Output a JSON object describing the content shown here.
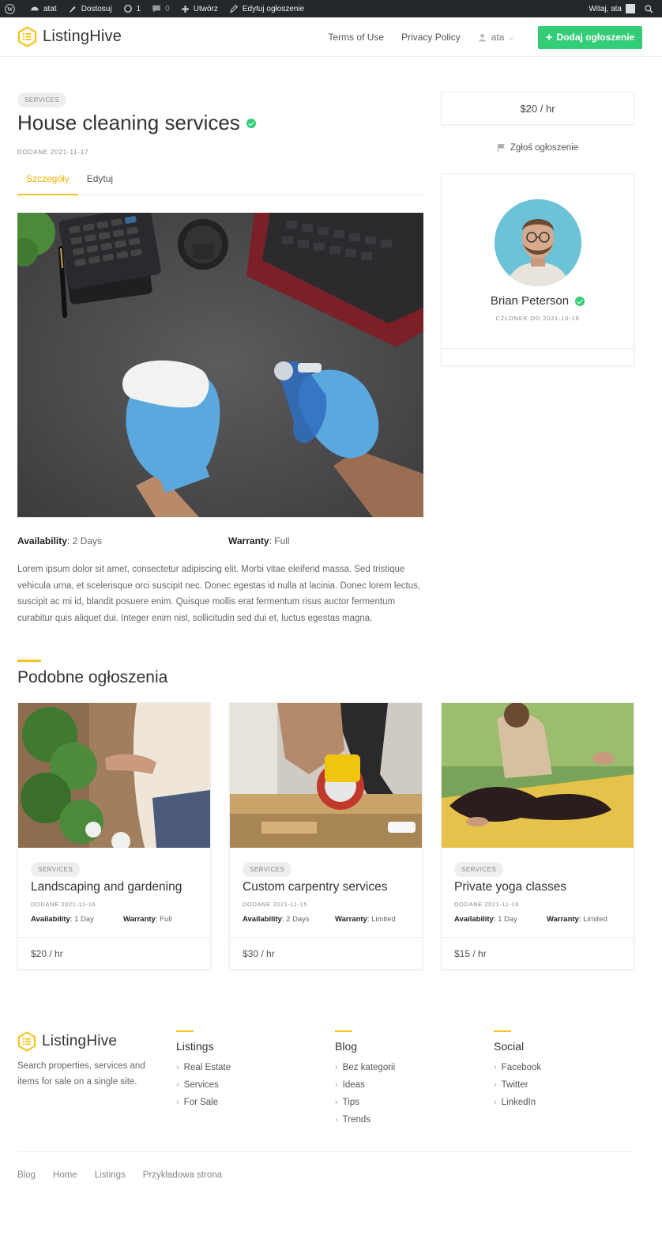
{
  "adminbar": {
    "site": "atat",
    "customize": "Dostosuj",
    "updates": "1",
    "comments": "0",
    "new": "Utwórz",
    "edit": "Edytuj ogłoszenie",
    "greeting": "Witaj, ata"
  },
  "header": {
    "logo": "ListingHive",
    "nav": [
      "Terms of Use",
      "Privacy Policy"
    ],
    "user": "ata",
    "add_button": "Dodaj ogłoszenie"
  },
  "listing": {
    "category": "Services",
    "title": "House cleaning services",
    "date": "Dodane 2021-11-17",
    "tabs": [
      "Szczegóły",
      "Edytuj"
    ],
    "availability_label": "Availability",
    "availability": "2 Days",
    "warranty_label": "Warranty",
    "warranty": "Full",
    "description": "Lorem ipsum dolor sit amet, consectetur adipiscing elit. Morbi vitae eleifend massa. Sed tristique vehicula urna, et scelerisque orci suscipit nec. Donec egestas id nulla at lacinia. Donec lorem lectus, suscipit ac mi id, blandit posuere enim. Quisque mollis erat fermentum risus auctor fermentum curabitur quis aliquet dui. Integer enim nisl, sollicitudin sed dui et, luctus egestas magna."
  },
  "sidebar": {
    "price": "$20 / hr",
    "report": "Zgłoś ogłoszenie",
    "vendor_name": "Brian Peterson",
    "vendor_since": "Członek od 2021-10-19"
  },
  "related": {
    "title": "Podobne ogłoszenia",
    "cards": [
      {
        "category": "Services",
        "title": "Landscaping and gardening",
        "date": "Dodane 2021-11-16",
        "availability_label": "Availability",
        "availability": "1 Day",
        "warranty_label": "Warranty",
        "warranty": "Full",
        "price": "$20 / hr"
      },
      {
        "category": "Services",
        "title": "Custom carpentry services",
        "date": "Dodane 2021-11-15",
        "availability_label": "Availability",
        "availability": "2 Days",
        "warranty_label": "Warranty",
        "warranty": "Limited",
        "price": "$30 / hr"
      },
      {
        "category": "Services",
        "title": "Private yoga classes",
        "date": "Dodane 2021-11-16",
        "availability_label": "Availability",
        "availability": "1 Day",
        "warranty_label": "Warranty",
        "warranty": "Limited",
        "price": "$15 / hr"
      }
    ]
  },
  "footer": {
    "logo": "ListingHive",
    "description": "Search properties, services and items for sale on a single site.",
    "columns": [
      {
        "title": "Listings",
        "items": [
          "Real Estate",
          "Services",
          "For Sale"
        ]
      },
      {
        "title": "Blog",
        "items": [
          "Bez kategorii",
          "Ideas",
          "Tips",
          "Trends"
        ]
      },
      {
        "title": "Social",
        "items": [
          "Facebook",
          "Twitter",
          "LinkedIn"
        ]
      }
    ],
    "menu": [
      "Blog",
      "Home",
      "Listings",
      "Przykładowa strona"
    ]
  },
  "colors": {
    "accent": "#f4c31f",
    "primary_button": "#33cc77",
    "verified": "#33cc77",
    "adminbar": "#23282d"
  }
}
